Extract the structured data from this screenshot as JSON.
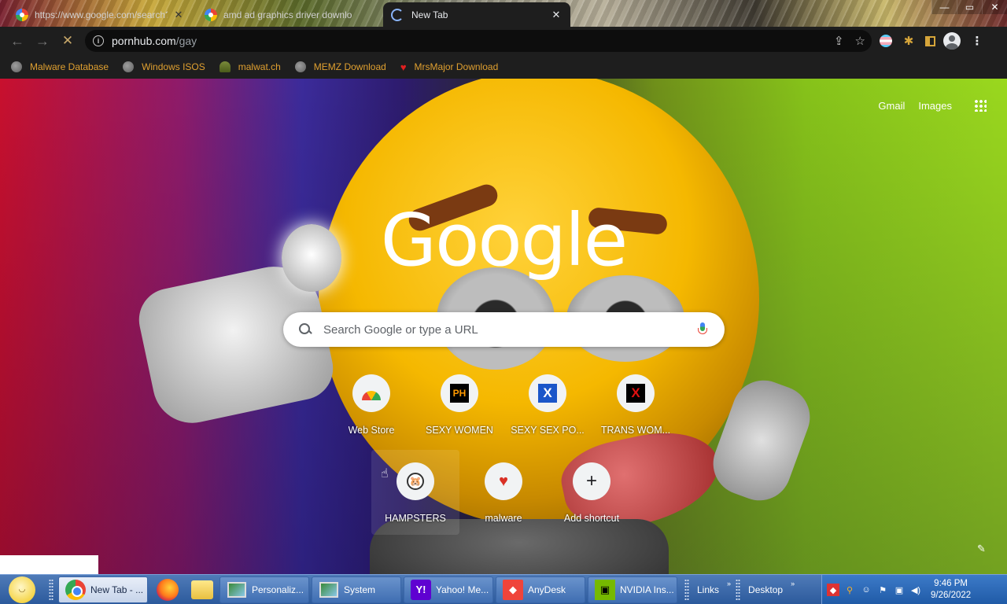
{
  "browser": {
    "tabs": [
      {
        "title": "https://www.google.com/search?",
        "active": false
      },
      {
        "title": "amd ad graphics driver downlo",
        "active": false
      },
      {
        "title": "New Tab",
        "active": true
      }
    ],
    "close_glyph": "✕",
    "window_controls": {
      "minimize": "—",
      "maximize": "▭",
      "close": "✕"
    },
    "omnibox": {
      "host": "pornhub.com",
      "path": "/gay",
      "info_glyph": "i"
    },
    "bookmarks": [
      {
        "label": "Malware Database",
        "icon": "globe-icon"
      },
      {
        "label": "Windows ISOS",
        "icon": "globe-icon"
      },
      {
        "label": "malwat.ch",
        "icon": "person-icon"
      },
      {
        "label": "MEMZ Download",
        "icon": "globe-icon"
      },
      {
        "label": "MrsMajor Download",
        "icon": "heart-icon"
      }
    ]
  },
  "ntp": {
    "top_links": {
      "gmail": "Gmail",
      "images": "Images"
    },
    "logo": "Google",
    "search": {
      "placeholder": "Search Google or type a URL",
      "value": ""
    },
    "shortcuts": [
      {
        "label": "Web Store",
        "icon": "webstore-icon"
      },
      {
        "label": "SEXY WOMEN",
        "icon": "ph-icon",
        "glyph": "PH"
      },
      {
        "label": "SEXY SEX PO...",
        "icon": "x-icon",
        "glyph": "X"
      },
      {
        "label": "TRANS WOM...",
        "icon": "x-red-icon",
        "glyph": "X"
      },
      {
        "label": "HAMPSTERS",
        "icon": "hamster-icon",
        "glyph": "🐹"
      },
      {
        "label": "malware",
        "icon": "heart-icon",
        "glyph": "♥"
      },
      {
        "label": "Add shortcut",
        "icon": "plus-icon",
        "glyph": "+"
      }
    ],
    "colors": {
      "gradient_left": "#c8102e",
      "gradient_mid": "#3b2b9a",
      "gradient_right": "#9ad81e",
      "smiley": "#f5b800"
    }
  },
  "taskbar": {
    "buttons": [
      {
        "label": "New Tab - ...",
        "icon": "chrome-icon",
        "active": true
      },
      {
        "label": "Personaliz...",
        "icon": "personalize-icon",
        "active": false
      },
      {
        "label": "System",
        "icon": "system-icon",
        "active": false
      },
      {
        "label": "Yahoo! Me...",
        "icon": "yahoo-icon",
        "glyph": "Y!",
        "active": false
      },
      {
        "label": "AnyDesk",
        "icon": "anydesk-icon",
        "glyph": "◆",
        "active": false
      },
      {
        "label": "NVIDIA Ins...",
        "icon": "nvidia-icon",
        "glyph": "▣",
        "active": false
      }
    ],
    "toolbars": {
      "links": "Links",
      "desktop": "Desktop"
    },
    "clock": {
      "time": "9:46 PM",
      "date": "9/26/2022"
    }
  }
}
